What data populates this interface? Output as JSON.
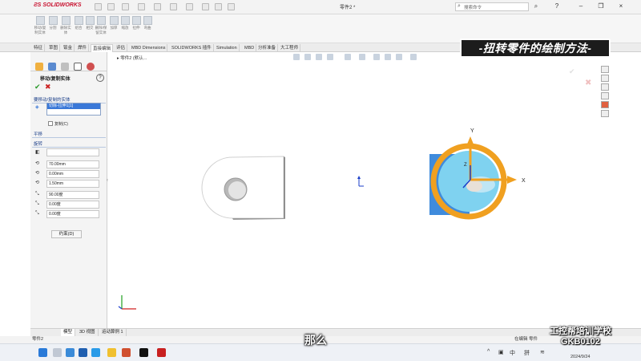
{
  "app": {
    "logo_text": "SOLIDWORKS",
    "document_title": "零件2 *",
    "search_placeholder": "搜索命令"
  },
  "ribbon": {
    "buttons": [
      "移动/复制实体",
      "分割",
      "删除实体",
      "组合",
      "相交",
      "删除/保留实体",
      "加厚",
      "缩放",
      "拉伸",
      "弯曲"
    ]
  },
  "tabs": [
    {
      "label": "特征"
    },
    {
      "label": "草图"
    },
    {
      "label": "钣金"
    },
    {
      "label": "焊件"
    },
    {
      "label": "直接编辑",
      "active": true
    },
    {
      "label": "评估"
    },
    {
      "label": "MBD Dimensions"
    },
    {
      "label": "SOLIDWORKS 插件"
    },
    {
      "label": "Simulation"
    },
    {
      "label": "MBD"
    },
    {
      "label": "分析准备"
    },
    {
      "label": "大工程师"
    }
  ],
  "property_manager": {
    "title": "移动/复制实体",
    "help": "?",
    "section_bodies": "要移动/复制的实体",
    "selected_body": "切除-拉伸1[1]",
    "copy_label": "复制(C)",
    "section_translate": "平移",
    "section_rotate": "旋转",
    "rot_x": "70.00mm",
    "rot_y": "0.00mm",
    "rot_z": "1.50mm",
    "angle_x": "90.00度",
    "angle_y": "0.00度",
    "angle_z": "0.00度",
    "constraint_button": "约束(D)"
  },
  "tree": {
    "root_label": "零件2 (默认..."
  },
  "banner": "-扭转零件的绘制方法-",
  "triad": {
    "x_label": "X",
    "y_label": "Y",
    "z_label": "Z"
  },
  "bottom_tabs": [
    "模型",
    "3D 视图",
    "运动算例 1"
  ],
  "status": {
    "left": "零件2",
    "right": "在编辑 零件"
  },
  "taskbar": {
    "ime_1": "中",
    "ime_2": "拼",
    "date": "2024/9/24"
  },
  "watermark": {
    "line1": "工控帮培训学校",
    "line2": "GKB0102"
  },
  "subtitle": "那么",
  "colors": {
    "banner_bg": "#1c1c1c",
    "part_gray": "#ffffff",
    "body_blue": "#2a9be8",
    "ring_orange": "#f0a020",
    "accent_select": "#3a78d8"
  }
}
